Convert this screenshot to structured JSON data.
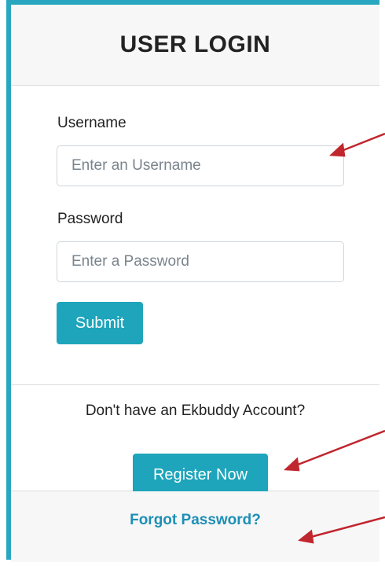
{
  "login": {
    "title": "USER LOGIN",
    "username_label": "Username",
    "username_placeholder": "Enter an Username",
    "password_label": "Password",
    "password_placeholder": "Enter a Password",
    "submit_label": "Submit"
  },
  "register": {
    "prompt": "Don't have an Ekbuddy Account?",
    "button_label": "Register Now"
  },
  "footer": {
    "forgot_label": "Forgot Password?"
  },
  "colors": {
    "accent": "#1ea5bb",
    "link": "#1d8fb5",
    "annotation_arrow": "#c0262d"
  }
}
